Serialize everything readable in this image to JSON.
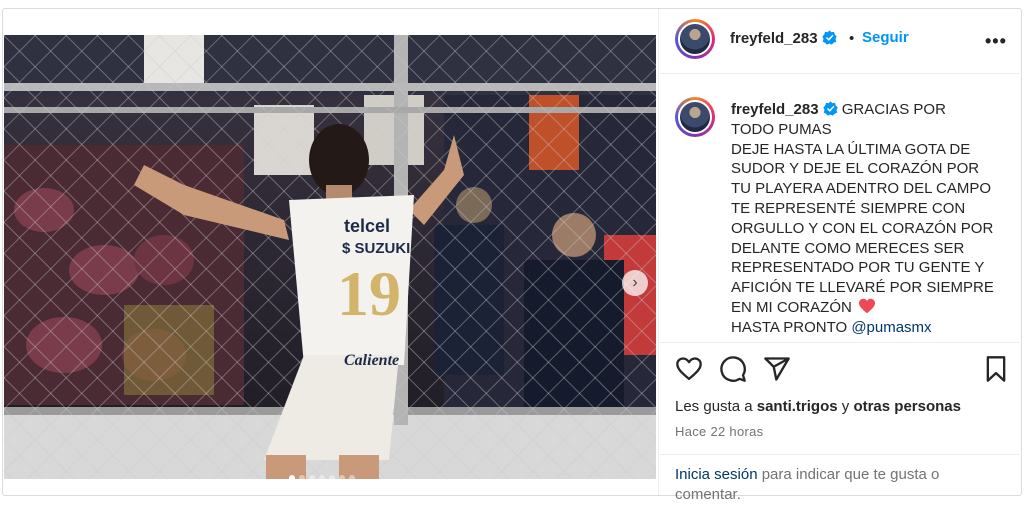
{
  "header": {
    "username": "freyfeld_283",
    "separator": "•",
    "follow_label": "Seguir",
    "more_label": "•••"
  },
  "image": {
    "alt": "Jugador de Pumas con el número 19 de espaldas saludando a la afición tras una reja",
    "jersey_number": "19",
    "sponsors": [
      "telcel",
      "SUZUKI",
      "Caliente"
    ]
  },
  "caption": {
    "username": "freyfeld_283",
    "lines": [
      "GRACIAS POR",
      "TODO PUMAS",
      "DEJE HASTA LA ÚLTIMA GOTA DE",
      "SUDOR Y DEJE EL CORAZÓN POR",
      "TU PLAYERA ADENTRO DEL CAMPO",
      "TE REPRESENTÉ SIEMPRE CON",
      "ORGULLO Y CON EL CORAZÓN POR",
      "DELANTE COMO MERECES SER",
      "REPRESENTADO POR TU GENTE Y",
      "AFICIÓN TE LLEVARÉ POR SIEMPRE",
      "EN MI CORAZÓN"
    ],
    "last_line": "HASTA PRONTO",
    "mention": "@pumasmx"
  },
  "likes": {
    "prefix": "Les gusta a",
    "user": "santi.trigos",
    "conj": "y",
    "others": "otras personas"
  },
  "time": "Hace 22 horas",
  "login": {
    "link": "Inicia sesión",
    "rest": "para indicar que te gusta o comentar."
  },
  "colors": {
    "accent": "#0095f6",
    "mention": "#00376b",
    "verified": "#0095f6",
    "heart": "#ed4956"
  },
  "icons": {
    "like": "heart-outline-icon",
    "comment": "comment-icon",
    "share": "share-icon",
    "save": "bookmark-icon",
    "next": "chevron-right-icon"
  }
}
